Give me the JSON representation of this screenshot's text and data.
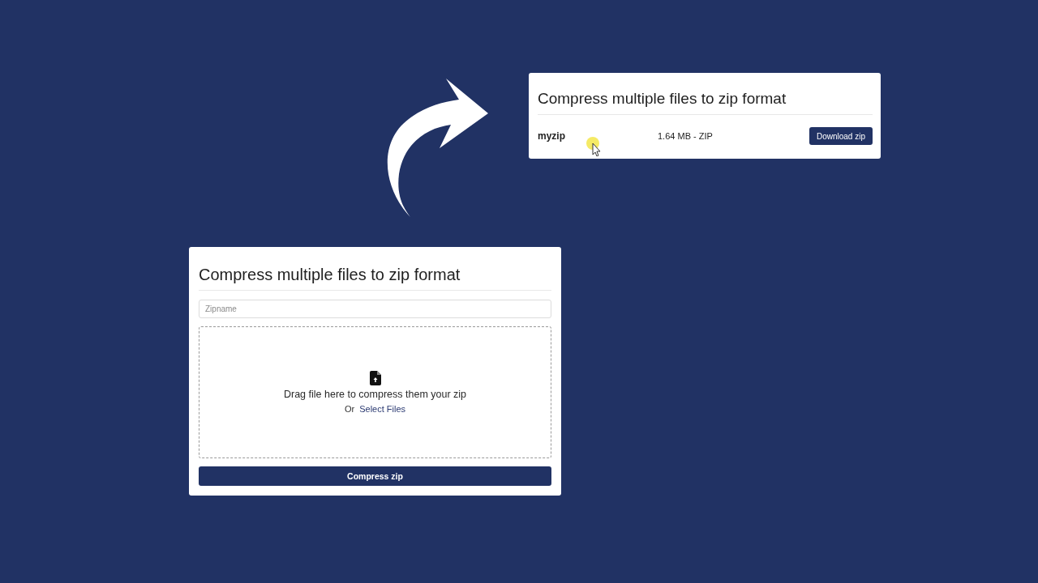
{
  "result_card": {
    "title": "Compress multiple files to zip format",
    "file": {
      "name": "myzip",
      "info": "1.64 MB - ZIP",
      "button": "Download zip"
    }
  },
  "upload_card": {
    "title": "Compress multiple files to zip format",
    "zipname": {
      "placeholder": "Zipname"
    },
    "dropzone": {
      "text": "Drag file here to compress them your zip",
      "or": "Or",
      "link": "Select Files"
    },
    "button": "Compress zip"
  }
}
